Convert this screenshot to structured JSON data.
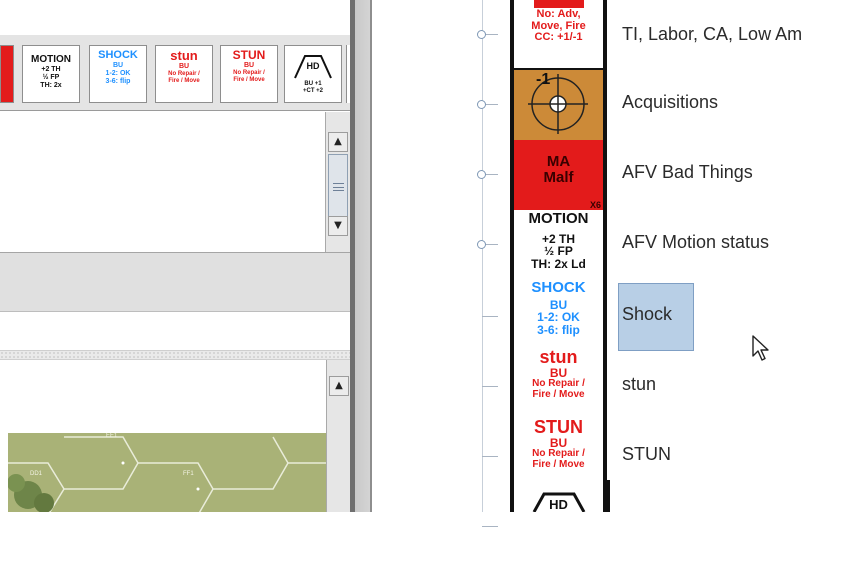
{
  "toolbar": {
    "chits": [
      {
        "title": "MOTION",
        "sub": "+2 TH",
        "sub2": "½ FP",
        "sub3": "TH: 2x",
        "color": "#111111"
      },
      {
        "title": "SHOCK",
        "sub": "BU",
        "sub2": "1-2: OK",
        "sub3": "3-6: flip",
        "color": "#1e90ff"
      },
      {
        "title": "stun",
        "sub": "BU",
        "sub2": "No Repair /",
        "sub3": "Fire / Move",
        "color": "#e31b1b"
      },
      {
        "title": "STUN",
        "sub": "BU",
        "sub2": "No Repair /",
        "sub3": "Fire / Move",
        "color": "#e31b1b"
      },
      {
        "title": "HD",
        "sub": "BU +1",
        "sub2": "+CT +2",
        "sub3": "",
        "color": "#111111"
      }
    ]
  },
  "map": {
    "hex_labels": [
      "EE1",
      "FF1",
      "DD1"
    ]
  },
  "tree": {
    "items": [
      {
        "label": "TI, Labor, CA, Low Am"
      },
      {
        "label": "Acquisitions"
      },
      {
        "label": "AFV Bad Things"
      },
      {
        "label": "AFV Motion status"
      },
      {
        "label": "Shock"
      },
      {
        "label": "stun"
      },
      {
        "label": "STUN"
      }
    ]
  },
  "strip": {
    "top_chit": {
      "line1": "No: Adv,",
      "line2": "Move, Fire",
      "line3": "CC: +1/-1"
    },
    "acq": {
      "value": "-1"
    },
    "ma": {
      "line1": "MA",
      "line2": "Malf",
      "corner": "X6"
    },
    "motion": {
      "title": "MOTION",
      "sub": "+2 TH",
      "sub2": "½ FP",
      "sub3": "TH: 2x Ld"
    },
    "shock": {
      "title": "SHOCK",
      "sub": "BU",
      "sub2": "1-2: OK",
      "sub3": "3-6: flip"
    },
    "stun": {
      "title": "stun",
      "sub": "BU",
      "sub2": "No Repair /",
      "sub3": "Fire / Move"
    },
    "stun2": {
      "title": "STUN",
      "sub": "BU",
      "sub2": "No Repair /",
      "sub3": "Fire / Move"
    },
    "hd": {
      "title": "HD"
    }
  },
  "colors": {
    "red": "#e31b1b",
    "blue": "#1e90ff",
    "orange": "#cc8a38",
    "highlight": "#b8cfe6"
  }
}
